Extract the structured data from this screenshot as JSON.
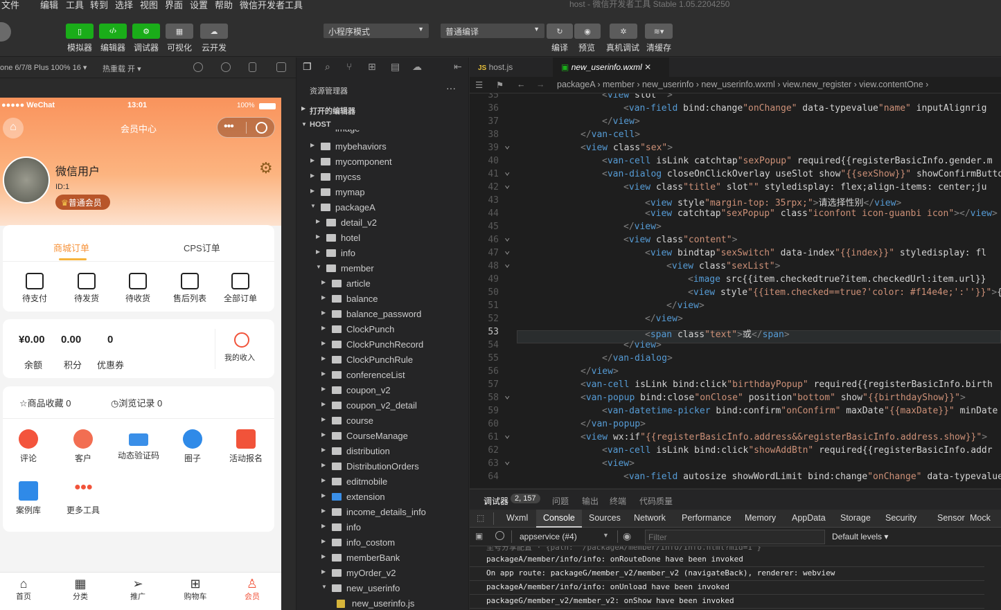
{
  "menu": {
    "items": [
      "文件",
      "编辑",
      "工具",
      "转到",
      "选择",
      "视图",
      "界面",
      "设置",
      "帮助",
      "微信开发者工具"
    ],
    "title": "host - 微信开发者工具 Stable 1.05.2204250"
  },
  "toolbar": {
    "buttons": [
      "模拟器",
      "编辑器",
      "调试器",
      "可视化",
      "云开发"
    ],
    "mode": "小程序模式",
    "compile": "普通编译",
    "actions": [
      "编译",
      "预览",
      "真机调试",
      "清缓存"
    ]
  },
  "sim": {
    "device": "one 6/7/8 Plus 100% 16 ▾",
    "hotreload": "热重载 开 ▾"
  },
  "phone": {
    "status": {
      "carrier": "●●●●● WeChat",
      "time": "13:01",
      "battery": "100%"
    },
    "nav_title": "会员中心",
    "user": {
      "name": "微信用户",
      "id": "ID:1",
      "badge": "普通会员"
    },
    "order_tabs": [
      "商城订单",
      "CPS订单"
    ],
    "orders": [
      "待支付",
      "待发货",
      "待收货",
      "售后列表",
      "全部订单"
    ],
    "stats": [
      {
        "value": "¥0.00",
        "label": "余额"
      },
      {
        "value": "0.00",
        "label": "积分"
      },
      {
        "value": "0",
        "label": "优惠券"
      }
    ],
    "income": "我的收入",
    "fav": "商品收藏 0",
    "history": "浏览记录 0",
    "services": [
      "评论",
      "客户",
      "动态验证码",
      "圈子",
      "活动报名",
      "案例库",
      "更多工具"
    ],
    "tabbar": [
      "首页",
      "分类",
      "推广",
      "购物车",
      "会员"
    ]
  },
  "explorer": {
    "title": "资源管理器",
    "open_editors": "打开的编辑器",
    "host": "HOST",
    "partial_top": "image",
    "items": [
      {
        "name": "mybehaviors",
        "level": 1
      },
      {
        "name": "mycomponent",
        "level": 1
      },
      {
        "name": "mycss",
        "level": 1
      },
      {
        "name": "mymap",
        "level": 1
      },
      {
        "name": "packageA",
        "level": 1,
        "open": true
      },
      {
        "name": "detail_v2",
        "level": 2
      },
      {
        "name": "hotel",
        "level": 2
      },
      {
        "name": "info",
        "level": 2
      },
      {
        "name": "member",
        "level": 2,
        "open": true
      },
      {
        "name": "article",
        "level": 3
      },
      {
        "name": "balance",
        "level": 3
      },
      {
        "name": "balance_password",
        "level": 3
      },
      {
        "name": "ClockPunch",
        "level": 3
      },
      {
        "name": "ClockPunchRecord",
        "level": 3
      },
      {
        "name": "ClockPunchRule",
        "level": 3
      },
      {
        "name": "conferenceList",
        "level": 3
      },
      {
        "name": "coupon_v2",
        "level": 3
      },
      {
        "name": "coupon_v2_detail",
        "level": 3
      },
      {
        "name": "course",
        "level": 3
      },
      {
        "name": "CourseManage",
        "level": 3
      },
      {
        "name": "distribution",
        "level": 3
      },
      {
        "name": "DistributionOrders",
        "level": 3
      },
      {
        "name": "editmobile",
        "level": 3
      },
      {
        "name": "extension",
        "level": 3
      },
      {
        "name": "income_details_info",
        "level": 3
      },
      {
        "name": "info",
        "level": 3
      },
      {
        "name": "info_costom",
        "level": 3
      },
      {
        "name": "memberBank",
        "level": 3
      },
      {
        "name": "myOrder_v2",
        "level": 3
      },
      {
        "name": "new_userinfo",
        "level": 3,
        "open": true
      },
      {
        "name": "new_userinfo.js",
        "level": 4,
        "file": true
      }
    ]
  },
  "editor": {
    "tabs": [
      "host.js",
      "new_userinfo.wxml"
    ],
    "breadcrumb": "packageA › member › new_userinfo › new_userinfo.wxml › view.new_register › view.contentOne ›",
    "lines": [
      {
        "n": "35",
        "fold": "",
        "indent": 4,
        "code": "<view slot=\"\">"
      },
      {
        "n": "36",
        "fold": "",
        "indent": 5,
        "code": "<van-field bind:change=\"onChange\" data-typevalue=\"name\" inputAlign=\"rig"
      },
      {
        "n": "37",
        "fold": "",
        "indent": 4,
        "code": "</view>"
      },
      {
        "n": "38",
        "fold": "",
        "indent": 3,
        "code": "</van-cell>"
      },
      {
        "n": "39",
        "fold": "v",
        "indent": 3,
        "code": "<view class=\"sex\">"
      },
      {
        "n": "40",
        "fold": "",
        "indent": 4,
        "code": "<van-cell isLink catchtap=\"sexPopup\" required=\"{{registerBasicInfo.gender.m"
      },
      {
        "n": "41",
        "fold": "v",
        "indent": 4,
        "code": "<van-dialog closeOnClickOverlay useSlot show=\"{{sexShow}}\" showConfirmButto"
      },
      {
        "n": "42",
        "fold": "v",
        "indent": 5,
        "code": "<view class=\"title\" slot=\"\" style=\"display: flex;align-items: center;ju"
      },
      {
        "n": "43",
        "fold": "",
        "indent": 6,
        "code": "<view style=\"margin-top: 35rpx;\">请选择性别</view>"
      },
      {
        "n": "44",
        "fold": "",
        "indent": 6,
        "code": "<view catchtap=\"sexPopup\" class=\"iconfont icon-guanbi icon\"></view>"
      },
      {
        "n": "45",
        "fold": "",
        "indent": 5,
        "code": "</view>"
      },
      {
        "n": "46",
        "fold": "v",
        "indent": 5,
        "code": "<view class=\"content\">"
      },
      {
        "n": "47",
        "fold": "v",
        "indent": 6,
        "code": "<view bindtap=\"sexSwitch\" data-index=\"{{index}}\" style=\"display: fl"
      },
      {
        "n": "48",
        "fold": "v",
        "indent": 7,
        "code": "<view class=\"sexList\">"
      },
      {
        "n": "49",
        "fold": "",
        "indent": 8,
        "code": "<image src=\"{{item.checked==true?item.checkedUrl:item.url}}"
      },
      {
        "n": "50",
        "fold": "",
        "indent": 8,
        "code": "<view style=\"{{item.checked==true?'color: #f14e4e;':''}}\">{"
      },
      {
        "n": "51",
        "fold": "",
        "indent": 7,
        "code": "</view>"
      },
      {
        "n": "52",
        "fold": "",
        "indent": 6,
        "code": "</view>"
      },
      {
        "n": "53",
        "fold": "",
        "indent": 6,
        "code": "<span class=\"text\">或</span>"
      },
      {
        "n": "54",
        "fold": "",
        "indent": 5,
        "code": "</view>"
      },
      {
        "n": "55",
        "fold": "",
        "indent": 4,
        "code": "</van-dialog>"
      },
      {
        "n": "56",
        "fold": "",
        "indent": 3,
        "code": "</view>"
      },
      {
        "n": "57",
        "fold": "",
        "indent": 3,
        "code": "<van-cell isLink bind:click=\"birthdayPopup\" required=\"{{registerBasicInfo.birth"
      },
      {
        "n": "58",
        "fold": "v",
        "indent": 3,
        "code": "<van-popup bind:close=\"onClose\" position=\"bottom\" show=\"{{birthdayShow}}\">"
      },
      {
        "n": "59",
        "fold": "",
        "indent": 4,
        "code": "<van-datetime-picker bind:confirm=\"onConfirm\" maxDate=\"{{maxDate}}\" minDate"
      },
      {
        "n": "60",
        "fold": "",
        "indent": 3,
        "code": "</van-popup>"
      },
      {
        "n": "61",
        "fold": "v",
        "indent": 3,
        "code": "<view wx:if=\"{{registerBasicInfo.address&&registerBasicInfo.address.show}}\">"
      },
      {
        "n": "62",
        "fold": "",
        "indent": 4,
        "code": "<van-cell isLink bind:click=\"showAddBtn\" required=\"{{registerBasicInfo.addr"
      },
      {
        "n": "63",
        "fold": "v",
        "indent": 4,
        "code": "<view>"
      },
      {
        "n": "64",
        "fold": "",
        "indent": 5,
        "code": "<van-field autosize showWordLimit bind:change=\"onChange\" data-typevalue"
      }
    ]
  },
  "devtools": {
    "top_tabs": [
      "调试器",
      "问题",
      "输出",
      "终端",
      "代码质量"
    ],
    "badge": "2, 157",
    "tabs": [
      "Wxml",
      "Console",
      "Sources",
      "Network",
      "Performance",
      "Memory",
      "AppData",
      "Storage",
      "Security",
      "Sensor",
      "Mock"
    ],
    "context": "appservice (#4)",
    "filter_placeholder": "Filter",
    "levels": "Default levels ▾",
    "logs": [
      "packageA/member/info/info: onRouteDone have been invoked",
      "On app route: packageG/member_v2/member_v2 (navigateBack), renderer: webview",
      "packageA/member/info/info: onUnload have been invoked",
      "packageG/member_v2/member_v2: onShow have been invoked"
    ]
  }
}
